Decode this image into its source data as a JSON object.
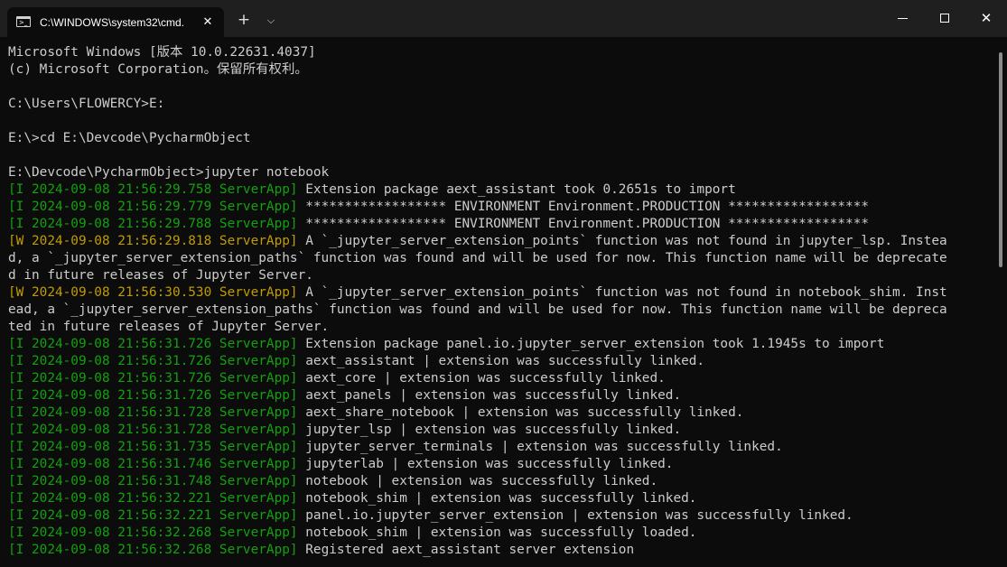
{
  "tab": {
    "title": "C:\\WINDOWS\\system32\\cmd.",
    "icon": "console-icon",
    "icon_glyph": ">_",
    "close_glyph": "✕"
  },
  "toolbar": {
    "new_tab_glyph": "+",
    "dropdown_glyph": "⌵"
  },
  "window_buttons": {
    "close_glyph": "✕"
  },
  "colors": {
    "info_prefix": "#13a10e",
    "warn_prefix": "#c19c00",
    "text": "#cccccc",
    "background": "#0c0c0c"
  },
  "console": {
    "lines": [
      {
        "type": "plain",
        "text": "Microsoft Windows [版本 10.0.22631.4037]"
      },
      {
        "type": "plain",
        "text": "(c) Microsoft Corporation。保留所有权利。"
      },
      {
        "type": "plain",
        "text": ""
      },
      {
        "type": "plain",
        "text": "C:\\Users\\FLOWERCY>E:"
      },
      {
        "type": "plain",
        "text": ""
      },
      {
        "type": "plain",
        "text": "E:\\>cd E:\\Devcode\\PycharmObject"
      },
      {
        "type": "plain",
        "text": ""
      },
      {
        "type": "plain",
        "text": "E:\\Devcode\\PycharmObject>jupyter notebook"
      },
      {
        "type": "I",
        "prefix": "[I 2024-09-08 21:56:29.758 ServerApp]",
        "text": " Extension package aext_assistant took 0.2651s to import"
      },
      {
        "type": "I",
        "prefix": "[I 2024-09-08 21:56:29.779 ServerApp]",
        "text": " ****************** ENVIRONMENT Environment.PRODUCTION ******************"
      },
      {
        "type": "I",
        "prefix": "[I 2024-09-08 21:56:29.788 ServerApp]",
        "text": " ****************** ENVIRONMENT Environment.PRODUCTION ******************"
      },
      {
        "type": "W",
        "prefix": "[W 2024-09-08 21:56:29.818 ServerApp]",
        "text": " A `_jupyter_server_extension_points` function was not found in jupyter_lsp. Instea"
      },
      {
        "type": "plain",
        "text": "d, a `_jupyter_server_extension_paths` function was found and will be used for now. This function name will be deprecate"
      },
      {
        "type": "plain",
        "text": "d in future releases of Jupyter Server."
      },
      {
        "type": "W",
        "prefix": "[W 2024-09-08 21:56:30.530 ServerApp]",
        "text": " A `_jupyter_server_extension_points` function was not found in notebook_shim. Inst"
      },
      {
        "type": "plain",
        "text": "ead, a `_jupyter_server_extension_paths` function was found and will be used for now. This function name will be depreca"
      },
      {
        "type": "plain",
        "text": "ted in future releases of Jupyter Server."
      },
      {
        "type": "I",
        "prefix": "[I 2024-09-08 21:56:31.726 ServerApp]",
        "text": " Extension package panel.io.jupyter_server_extension took 1.1945s to import"
      },
      {
        "type": "I",
        "prefix": "[I 2024-09-08 21:56:31.726 ServerApp]",
        "text": " aext_assistant | extension was successfully linked."
      },
      {
        "type": "I",
        "prefix": "[I 2024-09-08 21:56:31.726 ServerApp]",
        "text": " aext_core | extension was successfully linked."
      },
      {
        "type": "I",
        "prefix": "[I 2024-09-08 21:56:31.726 ServerApp]",
        "text": " aext_panels | extension was successfully linked."
      },
      {
        "type": "I",
        "prefix": "[I 2024-09-08 21:56:31.728 ServerApp]",
        "text": " aext_share_notebook | extension was successfully linked."
      },
      {
        "type": "I",
        "prefix": "[I 2024-09-08 21:56:31.728 ServerApp]",
        "text": " jupyter_lsp | extension was successfully linked."
      },
      {
        "type": "I",
        "prefix": "[I 2024-09-08 21:56:31.735 ServerApp]",
        "text": " jupyter_server_terminals | extension was successfully linked."
      },
      {
        "type": "I",
        "prefix": "[I 2024-09-08 21:56:31.746 ServerApp]",
        "text": " jupyterlab | extension was successfully linked."
      },
      {
        "type": "I",
        "prefix": "[I 2024-09-08 21:56:31.748 ServerApp]",
        "text": " notebook | extension was successfully linked."
      },
      {
        "type": "I",
        "prefix": "[I 2024-09-08 21:56:32.221 ServerApp]",
        "text": " notebook_shim | extension was successfully linked."
      },
      {
        "type": "I",
        "prefix": "[I 2024-09-08 21:56:32.221 ServerApp]",
        "text": " panel.io.jupyter_server_extension | extension was successfully linked."
      },
      {
        "type": "I",
        "prefix": "[I 2024-09-08 21:56:32.268 ServerApp]",
        "text": " notebook_shim | extension was successfully loaded."
      },
      {
        "type": "I",
        "prefix": "[I 2024-09-08 21:56:32.268 ServerApp]",
        "text": " Registered aext_assistant server extension"
      }
    ]
  }
}
